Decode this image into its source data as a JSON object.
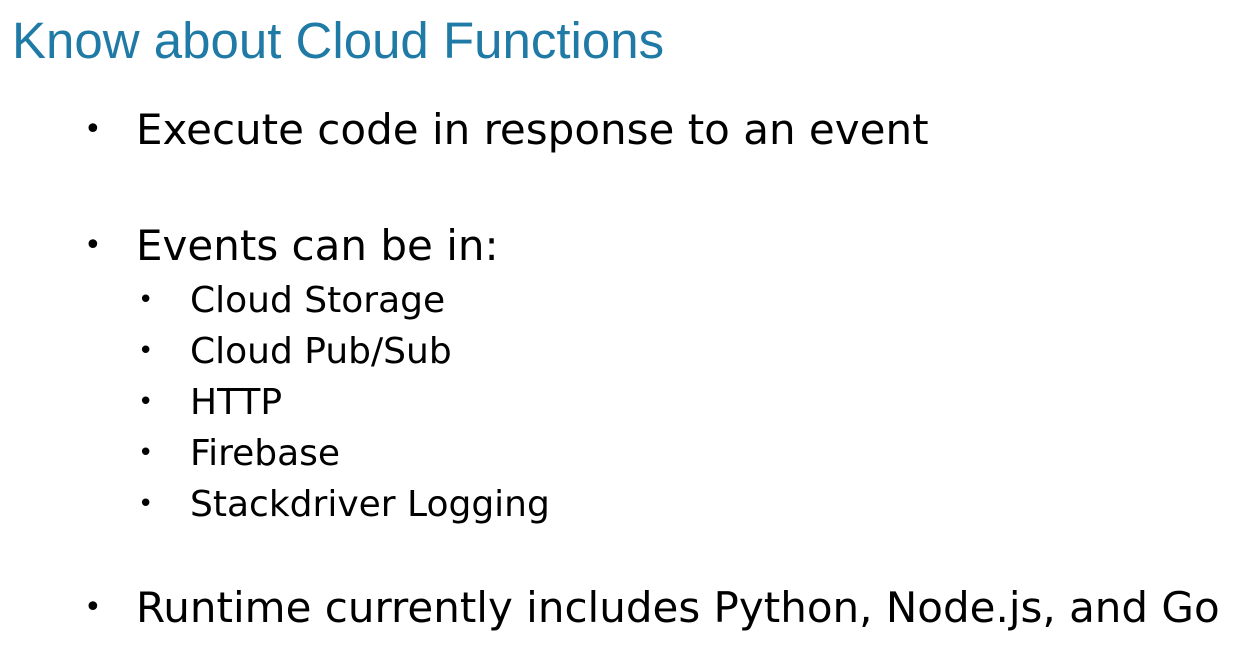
{
  "slide": {
    "title": "Know about Cloud Functions",
    "bullet_glyph": "•",
    "bullets": [
      {
        "text": "Execute code in response to an event"
      },
      {
        "text": "Events can be in:",
        "subitems": [
          "Cloud Storage",
          "Cloud Pub/Sub",
          "HTTP",
          "Firebase",
          "Stackdriver Logging"
        ]
      },
      {
        "text": "Runtime currently includes Python, Node.js, and Go"
      }
    ],
    "colors": {
      "title": "#1f7aa6",
      "body_text": "#000000",
      "background": "#ffffff"
    }
  }
}
